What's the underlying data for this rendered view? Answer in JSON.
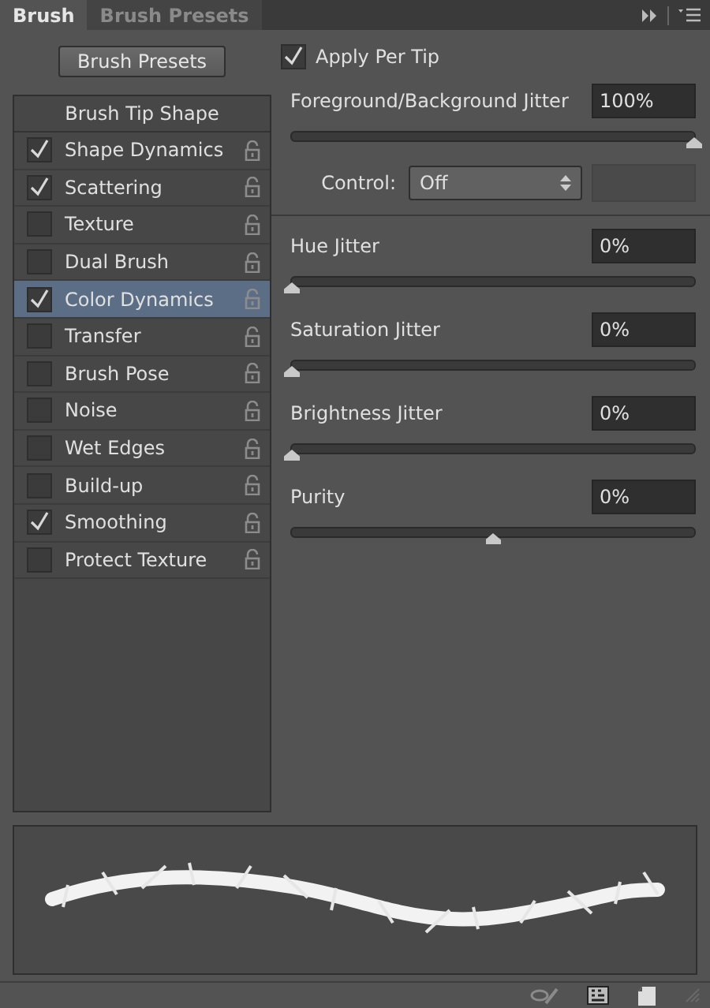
{
  "tabs": [
    {
      "label": "Brush",
      "selected": true
    },
    {
      "label": "Brush Presets",
      "selected": false
    }
  ],
  "presets_button": "Brush Presets",
  "options": [
    {
      "kind": "heading",
      "label": "Brush Tip Shape",
      "selected": false
    },
    {
      "kind": "option",
      "label": "Shape Dynamics",
      "checked": true,
      "selected": false
    },
    {
      "kind": "option",
      "label": "Scattering",
      "checked": true,
      "selected": false
    },
    {
      "kind": "option",
      "label": "Texture",
      "checked": false,
      "selected": false
    },
    {
      "kind": "option",
      "label": "Dual Brush",
      "checked": false,
      "selected": false
    },
    {
      "kind": "option",
      "label": "Color Dynamics",
      "checked": true,
      "selected": true
    },
    {
      "kind": "option",
      "label": "Transfer",
      "checked": false,
      "selected": false
    },
    {
      "kind": "option",
      "label": "Brush Pose",
      "checked": false,
      "selected": false
    },
    {
      "kind": "option",
      "label": "Noise",
      "checked": false,
      "selected": false
    },
    {
      "kind": "option",
      "label": "Wet Edges",
      "checked": false,
      "selected": false
    },
    {
      "kind": "option",
      "label": "Build-up",
      "checked": false,
      "selected": false
    },
    {
      "kind": "option",
      "label": "Smoothing",
      "checked": true,
      "selected": false
    },
    {
      "kind": "option",
      "label": "Protect Texture",
      "checked": false,
      "selected": false
    }
  ],
  "apply_per_tip": {
    "label": "Apply Per Tip",
    "checked": true
  },
  "controls": [
    {
      "kind": "slider",
      "label": "Foreground/Background Jitter",
      "value": "100%",
      "level": 1
    },
    {
      "kind": "dropdown",
      "label": "Control:",
      "value": "Off",
      "extra_field_disabled": true
    },
    {
      "kind": "divider"
    },
    {
      "kind": "slider",
      "label": "Hue Jitter",
      "value": "0%",
      "level": 0
    },
    {
      "kind": "slider",
      "label": "Saturation Jitter",
      "value": "0%",
      "level": 0
    },
    {
      "kind": "slider",
      "label": "Brightness Jitter",
      "value": "0%",
      "level": 0
    },
    {
      "kind": "slider",
      "label": "Purity",
      "value": "0%",
      "level": 0.5
    }
  ]
}
